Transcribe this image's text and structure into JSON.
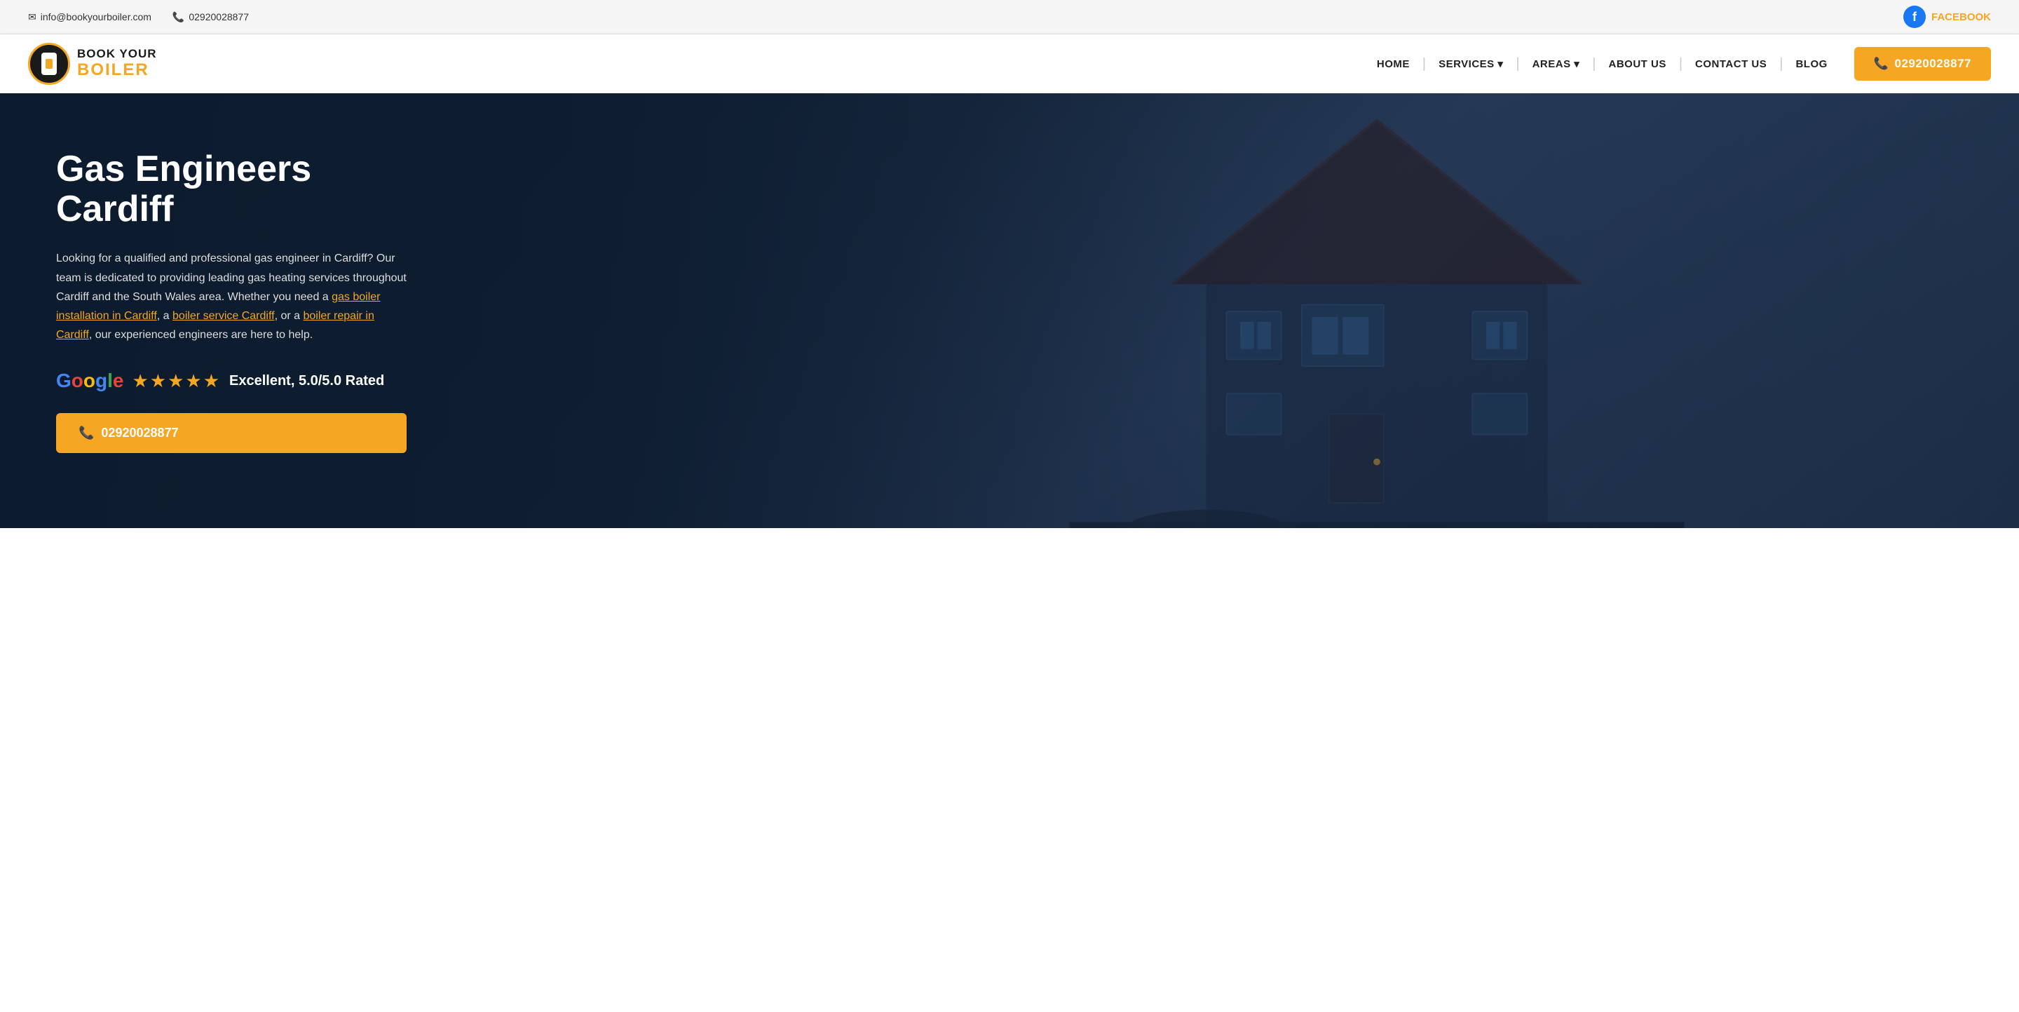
{
  "topbar": {
    "email": "info@bookyourboiler.com",
    "phone": "02920028877",
    "facebook_label": "FACEBOOK"
  },
  "navbar": {
    "logo_top": "BOOK YOUR",
    "logo_bottom": "BOILER",
    "nav_items": [
      {
        "label": "HOME",
        "has_dropdown": false
      },
      {
        "label": "SERVICES",
        "has_dropdown": true
      },
      {
        "label": "AREAS",
        "has_dropdown": true
      },
      {
        "label": "ABOUT US",
        "has_dropdown": false
      },
      {
        "label": "CONTACT US",
        "has_dropdown": false
      },
      {
        "label": "BLOG",
        "has_dropdown": false
      }
    ],
    "cta_phone": "02920028877"
  },
  "hero": {
    "title": "Gas Engineers Cardiff",
    "description_plain": "Looking for a qualified and professional gas engineer in Cardiff? Our team is dedicated to providing leading gas heating services throughout Cardiff and the South Wales area. Whether you need a ",
    "link1": "gas boiler installation in Cardiff",
    "description_mid": ", a ",
    "link2": "boiler service Cardiff",
    "description_mid2": ", or a ",
    "link3": "boiler repair in Cardiff",
    "description_end": ", our experienced engineers are here to help.",
    "google_label": "Google",
    "stars": "★★★★★",
    "rating": "Excellent, 5.0/5.0 Rated",
    "cta_phone": "02920028877"
  }
}
